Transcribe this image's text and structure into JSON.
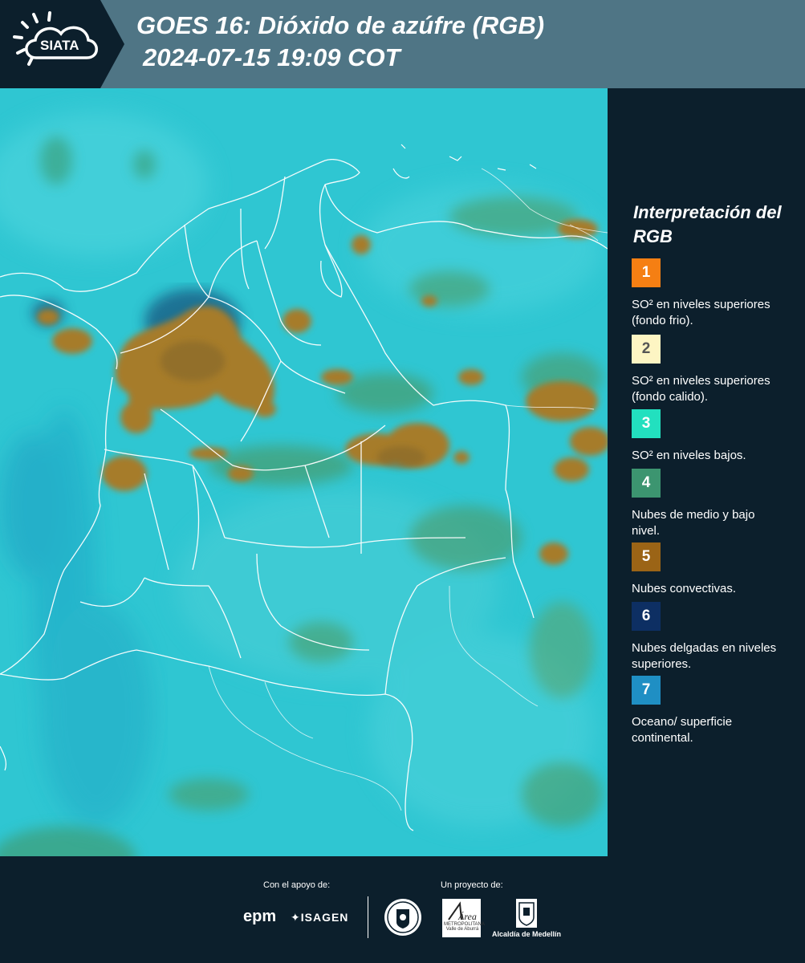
{
  "header": {
    "logo_text": "SIATA",
    "title_line1": "GOES 16: Dióxido de azúfre (RGB)",
    "title_line2": "2024-07-15 19:09 COT"
  },
  "legend": {
    "title": "Interpretación del RGB",
    "items": [
      {
        "number": "1",
        "color": "#f57f13",
        "text_color": "#ffffff",
        "label": "SO² en niveles superiores (fondo frio)."
      },
      {
        "number": "2",
        "color": "#fdf5c3",
        "text_color": "#555555",
        "label": "SO² en niveles superiores (fondo calido)."
      },
      {
        "number": "3",
        "color": "#22e0bf",
        "text_color": "#ffffff",
        "label": "SO² en niveles bajos."
      },
      {
        "number": "4",
        "color": "#3c9570",
        "text_color": "#ffffff",
        "label": "Nubes de medio y bajo nivel."
      },
      {
        "number": "5",
        "color": "#9b6416",
        "text_color": "#ffffff",
        "label": "Nubes convectivas."
      },
      {
        "number": "6",
        "color": "#0d2f63",
        "text_color": "#ffffff",
        "label": "Nubes delgadas en niveles superiores."
      },
      {
        "number": "7",
        "color": "#1f8fc4",
        "text_color": "#ffffff",
        "label": "Oceano/ superficie continental."
      }
    ]
  },
  "footer": {
    "support_label": "Con el apoyo de:",
    "project_label": "Un proyecto de:",
    "sponsor_1": "epm",
    "sponsor_2": "ISAGEN",
    "area_name": "Área",
    "area_caption": "METROPOLITANA Valle de Aburrá",
    "alcaldia": "Alcaldía de Medellín"
  },
  "colors": {
    "header_bg": "#4f7585",
    "panel_bg": "#0c1f2c",
    "ocean_cyan": "#2fc6d2",
    "cloud_brown": "#a67c2a"
  }
}
